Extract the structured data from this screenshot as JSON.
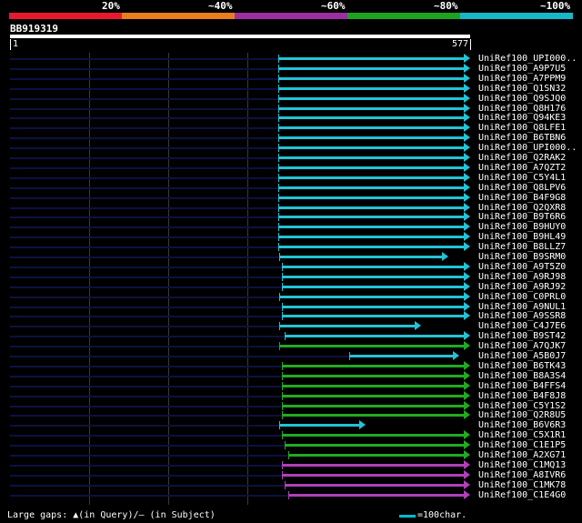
{
  "scale": {
    "labels": [
      "20%",
      "~40%",
      "~60%",
      "~80%",
      "~100%"
    ],
    "colors": [
      "#e8192c",
      "#e87d1e",
      "#9c2fa0",
      "#1ea31e",
      "#18b7c8"
    ]
  },
  "query": {
    "id": "BB919319",
    "start": "1",
    "end": "577"
  },
  "colors": {
    "unaligned": "#0d1140",
    "gridline": "#3a3a3a",
    "cyan": "#22c3d6",
    "green": "#22aa22",
    "purple": "#b040b8"
  },
  "hits": [
    {
      "label": "UniRef100_UPI000..",
      "color": "cyan"
    },
    {
      "label": "UniRef100_A9P7U5",
      "color": "cyan"
    },
    {
      "label": "UniRef100_A7PPM9",
      "color": "cyan"
    },
    {
      "label": "UniRef100_Q1SN32",
      "color": "cyan"
    },
    {
      "label": "UniRef100_Q9SJQ0",
      "color": "cyan"
    },
    {
      "label": "UniRef100_Q8H176",
      "color": "cyan"
    },
    {
      "label": "UniRef100_Q94KE3",
      "color": "cyan"
    },
    {
      "label": "UniRef100_Q8LFE1",
      "color": "cyan"
    },
    {
      "label": "UniRef100_B6TBN6",
      "color": "cyan"
    },
    {
      "label": "UniRef100_UPI000..",
      "color": "cyan"
    },
    {
      "label": "UniRef100_Q2RAK2",
      "color": "cyan"
    },
    {
      "label": "UniRef100_A7QZT2",
      "color": "cyan"
    },
    {
      "label": "UniRef100_C5Y4L1",
      "color": "cyan"
    },
    {
      "label": "UniRef100_Q8LPV6",
      "color": "cyan"
    },
    {
      "label": "UniRef100_B4F9G8",
      "color": "cyan"
    },
    {
      "label": "UniRef100_Q2QXR8",
      "color": "cyan"
    },
    {
      "label": "UniRef100_B9T6R6",
      "color": "cyan"
    },
    {
      "label": "UniRef100_B9HUY0",
      "color": "cyan"
    },
    {
      "label": "UniRef100_B9HL49",
      "color": "cyan"
    },
    {
      "label": "UniRef100_B8LLZ7",
      "color": "cyan"
    },
    {
      "label": "UniRef100_B9SRM0",
      "color": "cyan"
    },
    {
      "label": "UniRef100_A9T5Z0",
      "color": "cyan"
    },
    {
      "label": "UniRef100_A9RJ98",
      "color": "cyan"
    },
    {
      "label": "UniRef100_A9RJ92",
      "color": "cyan"
    },
    {
      "label": "UniRef100_C0PRL0",
      "color": "cyan"
    },
    {
      "label": "UniRef100_A9NUL1",
      "color": "cyan"
    },
    {
      "label": "UniRef100_A9SSR8",
      "color": "cyan"
    },
    {
      "label": "UniRef100_C4J7E6",
      "color": "cyan"
    },
    {
      "label": "UniRef100_B9ST42",
      "color": "cyan"
    },
    {
      "label": "UniRef100_A7QJK7",
      "color": "green"
    },
    {
      "label": "UniRef100_A5B0J7",
      "color": "cyan"
    },
    {
      "label": "UniRef100_B6TK43",
      "color": "green"
    },
    {
      "label": "UniRef100_B8A3S4",
      "color": "green"
    },
    {
      "label": "UniRef100_B4FFS4",
      "color": "green"
    },
    {
      "label": "UniRef100_B4F8J8",
      "color": "green"
    },
    {
      "label": "UniRef100_C5Y1S2",
      "color": "green"
    },
    {
      "label": "UniRef100_Q2R8U5",
      "color": "green"
    },
    {
      "label": "UniRef100_B6V6R3",
      "color": "cyan"
    },
    {
      "label": "UniRef100_C5X1R1",
      "color": "green"
    },
    {
      "label": "UniRef100_C1E1P5",
      "color": "green"
    },
    {
      "label": "UniRef100_A2XG71",
      "color": "green"
    },
    {
      "label": "UniRef100_C1MQ13",
      "color": "purple"
    },
    {
      "label": "UniRef100_A8IVR6",
      "color": "purple"
    },
    {
      "label": "UniRef100_C1MK78",
      "color": "purple"
    },
    {
      "label": "UniRef100_C1E4G0",
      "color": "purple"
    }
  ],
  "footer": {
    "gaps_text": "Large gaps: ▲(in Query)/– (in Subject)",
    "legend_text": "=100char."
  }
}
